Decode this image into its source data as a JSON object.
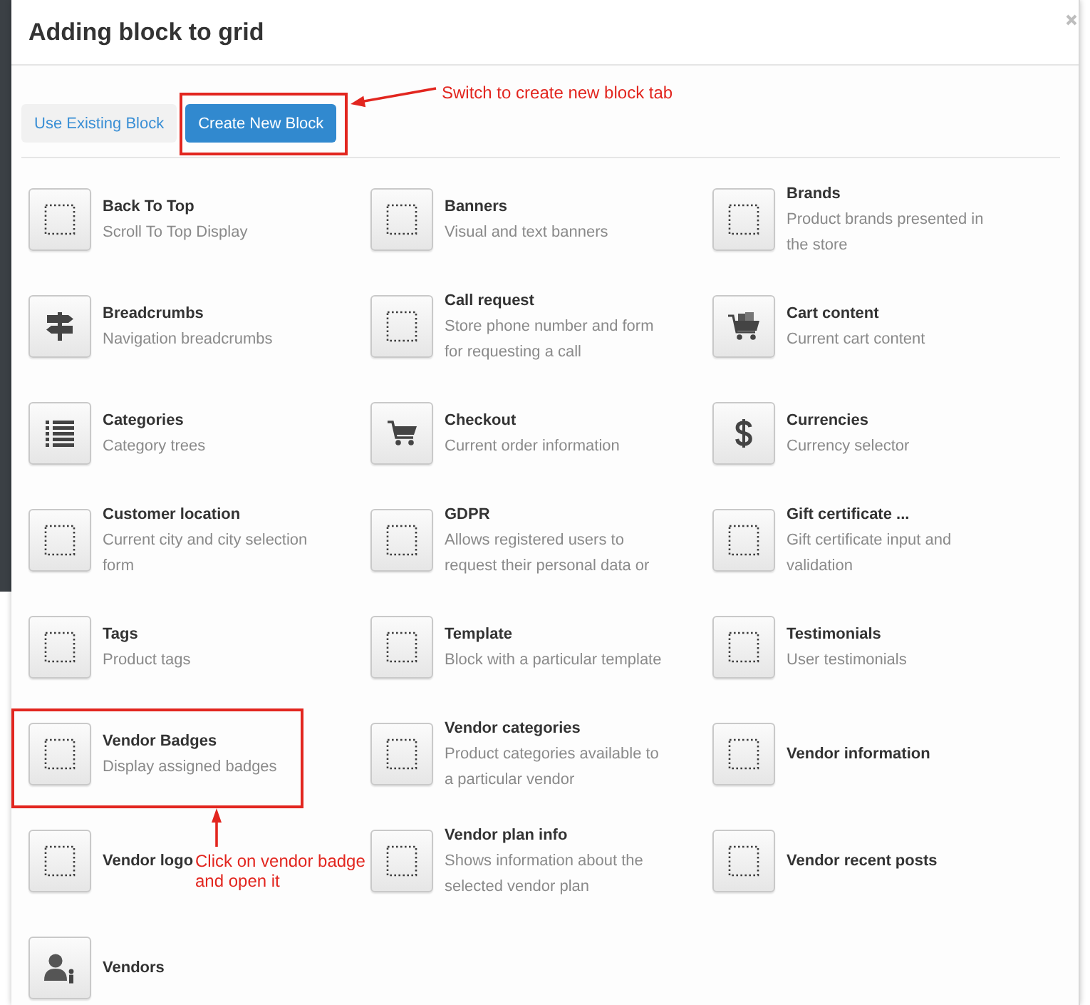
{
  "dialog": {
    "title": "Adding block to grid"
  },
  "tabs": [
    {
      "label": "Use Existing Block",
      "selected": false
    },
    {
      "label": "Create New Block",
      "selected": true
    }
  ],
  "blocks": [
    {
      "kind": "placeholder",
      "name": "Back To Top",
      "description": "Scroll To Top Display"
    },
    {
      "kind": "placeholder",
      "name": "Banners",
      "description": "Visual and text banners"
    },
    {
      "kind": "placeholder",
      "name": "Brands",
      "description": "Product brands presented in\nthe store"
    },
    {
      "kind": "signpost",
      "name": "Breadcrumbs",
      "description": "Navigation breadcrumbs"
    },
    {
      "kind": "placeholder",
      "name": "Call request",
      "description": "Store phone number and form\nfor requesting a call"
    },
    {
      "kind": "basket",
      "name": "Cart content",
      "description": "Current cart content"
    },
    {
      "kind": "list",
      "name": "Categories",
      "description": "Category trees"
    },
    {
      "kind": "cart",
      "name": "Checkout",
      "description": "Current order information"
    },
    {
      "kind": "dollar",
      "name": "Currencies",
      "description": "Currency selector"
    },
    {
      "kind": "placeholder",
      "name": "Customer location",
      "description": "Current city and city selection\nform"
    },
    {
      "kind": "placeholder",
      "name": "GDPR",
      "description": "Allows registered users to\nrequest their personal data or"
    },
    {
      "kind": "placeholder",
      "name": "Gift certificate ...",
      "description": "Gift certificate input and\nvalidation"
    },
    {
      "kind": "placeholder",
      "name": "Tags",
      "description": "Product tags"
    },
    {
      "kind": "placeholder",
      "name": "Template",
      "description": "Block with a particular template"
    },
    {
      "kind": "placeholder",
      "name": "Testimonials",
      "description": "User testimonials"
    },
    {
      "kind": "placeholder",
      "name": "Vendor Badges",
      "description": "Display assigned badges"
    },
    {
      "kind": "placeholder",
      "name": "Vendor categories",
      "description": "Product categories available to\na particular vendor"
    },
    {
      "kind": "placeholder",
      "name": "Vendor information"
    },
    {
      "kind": "placeholder",
      "name": "Vendor logo"
    },
    {
      "kind": "placeholder",
      "name": "Vendor plan info",
      "description": "Shows information about the\nselected vendor plan"
    },
    {
      "kind": "placeholder",
      "name": "Vendor recent posts"
    },
    {
      "kind": "person",
      "name": "Vendors"
    }
  ],
  "annotations": [
    {
      "text": "Switch to create new block tab"
    },
    {
      "text": "Click on vendor badge and open it"
    }
  ]
}
